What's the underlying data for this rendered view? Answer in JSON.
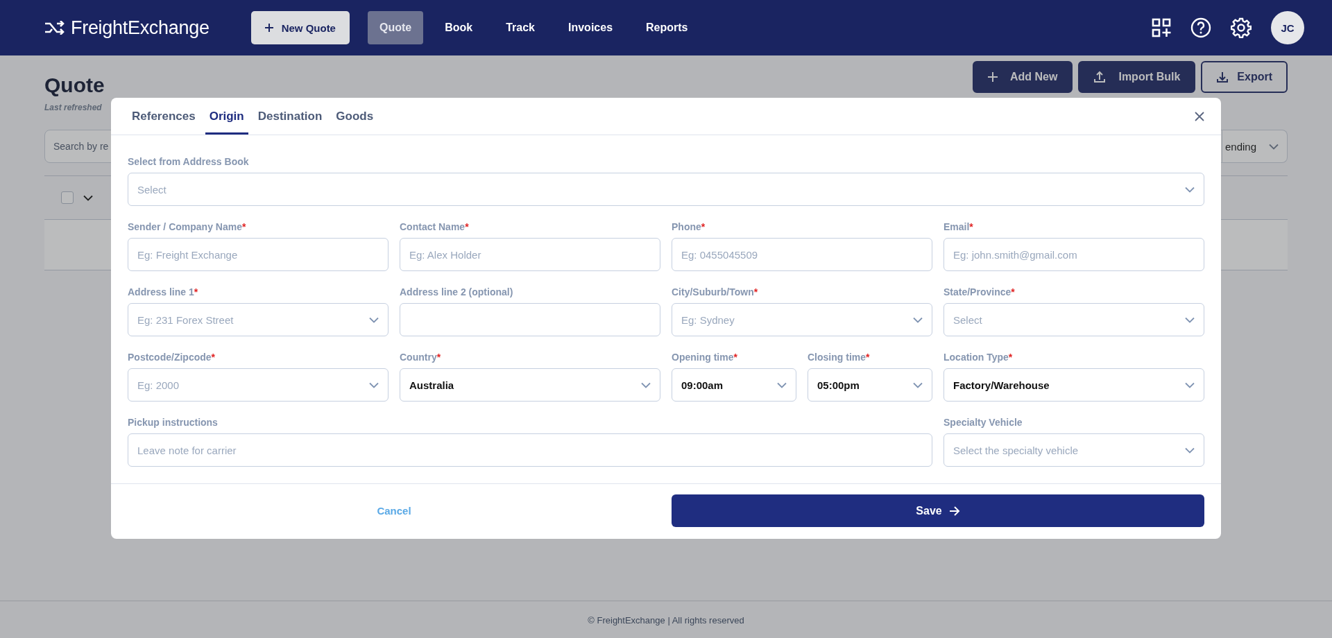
{
  "header": {
    "logo": "FreightExchange",
    "new_quote": "New Quote",
    "nav": [
      {
        "label": "Quote",
        "selected": true
      },
      {
        "label": "Book",
        "selected": false
      },
      {
        "label": "Track",
        "selected": false
      },
      {
        "label": "Invoices",
        "selected": false
      },
      {
        "label": "Reports",
        "selected": false
      }
    ],
    "avatar": "JC"
  },
  "page": {
    "title": "Quote",
    "subtitle": "Last refreshed",
    "actions": [
      {
        "label": "Add New",
        "kind": "add"
      },
      {
        "label": "Import Bulk",
        "kind": "import"
      },
      {
        "label": "Export",
        "kind": "export"
      }
    ],
    "search": {
      "placeholder": "Search by re"
    },
    "sort": {
      "value": "ending"
    },
    "select_all": {
      "checked": false
    }
  },
  "modal": {
    "tabs": [
      {
        "label": "References",
        "selected": false
      },
      {
        "label": "Origin",
        "selected": true
      },
      {
        "label": "Destination",
        "selected": false
      },
      {
        "label": "Goods",
        "selected": false
      }
    ],
    "address_book": {
      "label": "Select from Address Book",
      "placeholder": "Select"
    },
    "required_mark": "*",
    "rows": [
      [
        {
          "label": "Sender / Company Name",
          "required": true,
          "kind": "text",
          "placeholder": "Eg: Freight Exchange"
        },
        {
          "label": "Contact Name",
          "required": true,
          "kind": "text",
          "placeholder": "Eg: Alex Holder"
        },
        {
          "label": "Phone",
          "required": true,
          "kind": "text",
          "placeholder": "Eg: 0455045509"
        },
        {
          "label": "Email",
          "required": true,
          "kind": "text",
          "placeholder": "Eg: john.smith@gmail.com"
        }
      ],
      [
        {
          "label": "Address line 1",
          "required": true,
          "kind": "select",
          "placeholder": "Eg: 231 Forex Street"
        },
        {
          "label": "Address line 2 (optional)",
          "required": false,
          "kind": "text"
        },
        {
          "label": "City/Suburb/Town",
          "required": true,
          "kind": "select",
          "placeholder": "Eg: Sydney"
        },
        {
          "label": "State/Province",
          "required": true,
          "kind": "select",
          "placeholder": "Select"
        }
      ],
      [
        {
          "label": "Postcode/Zipcode",
          "required": true,
          "kind": "select",
          "placeholder": "Eg: 2000"
        },
        {
          "label": "Country",
          "required": true,
          "kind": "select",
          "value": "Australia"
        },
        {
          "kind": "pair",
          "fields": [
            {
              "label": "Opening time",
              "required": true,
              "kind": "select",
              "value": "09:00am"
            },
            {
              "label": "Closing time",
              "required": true,
              "kind": "select",
              "value": "05:00pm"
            }
          ]
        },
        {
          "label": "Location Type",
          "required": true,
          "kind": "select",
          "value": "Factory/Warehouse"
        }
      ]
    ],
    "pickup_instructions": {
      "label": "Pickup instructions",
      "required": false,
      "kind": "text",
      "placeholder": "Leave note for carrier"
    },
    "specialty_vehicle": {
      "label": "Specialty Vehicle",
      "required": false,
      "kind": "select",
      "placeholder": "Select the specialty vehicle"
    },
    "cancel": "Cancel",
    "save": "Save"
  },
  "footer": "© FreightExchange | All rights reserved"
}
